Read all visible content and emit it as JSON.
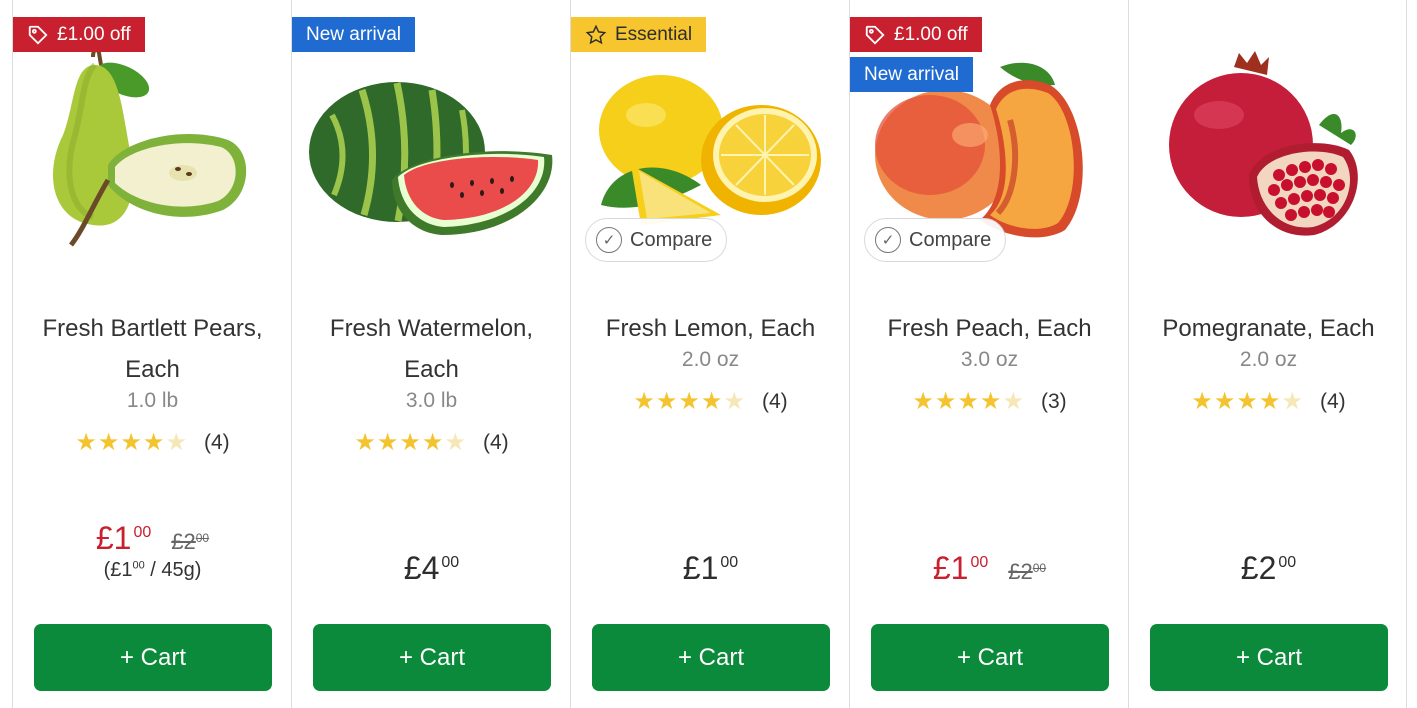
{
  "products": [
    {
      "name": "Fresh Bartlett Pears, Each",
      "size": "1.0 lb",
      "rating_value": 4,
      "rating_count": "(4)",
      "price_whole": "£1",
      "price_cents": "00",
      "was_whole": "£2",
      "was_cents": "00",
      "unit_whole": "(£1",
      "unit_cents": "00",
      "unit_rest": "/ 45g)",
      "badge_deal": "£1.00 off",
      "cart_label": "+ Cart"
    },
    {
      "name": "Fresh Watermelon, Each",
      "size": "3.0 lb",
      "rating_value": 4,
      "rating_count": "(4)",
      "price_whole": "£4",
      "price_cents": "00",
      "badge_new": "New arrival",
      "cart_label": "+ Cart"
    },
    {
      "name": "Fresh Lemon, Each",
      "size": "2.0 oz",
      "rating_value": 4,
      "rating_count": "(4)",
      "price_whole": "£1",
      "price_cents": "00",
      "badge_essential": "Essential",
      "compare_label": "Compare",
      "cart_label": "+ Cart"
    },
    {
      "name": "Fresh Peach, Each",
      "size": "3.0 oz",
      "rating_value": 4,
      "rating_count": "(3)",
      "price_whole": "£1",
      "price_cents": "00",
      "was_whole": "£2",
      "was_cents": "00",
      "badge_deal": "£1.00 off",
      "badge_new": "New arrival",
      "compare_label": "Compare",
      "cart_label": "+ Cart"
    },
    {
      "name": "Pomegranate, Each",
      "size": "2.0 oz",
      "rating_value": 4,
      "rating_count": "(4)",
      "price_whole": "£2",
      "price_cents": "00",
      "cart_label": "+ Cart"
    }
  ],
  "icons": {
    "deal": "tag-icon",
    "essential": "star-outline-icon",
    "compare": "check-circle-icon"
  },
  "colors": {
    "sale": "#c8202e",
    "new_badge": "#1f6bd1",
    "essential_badge": "#f7c52d",
    "cart_button": "#0a8a3a",
    "star": "#f4c430"
  }
}
